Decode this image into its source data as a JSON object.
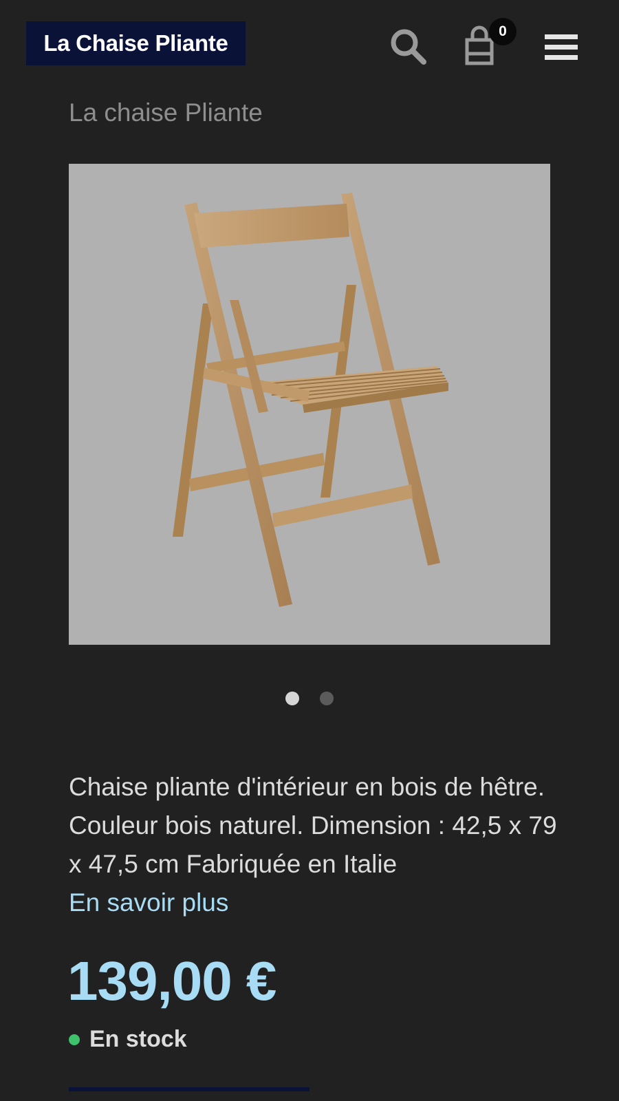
{
  "header": {
    "logo_text": "La Chaise Pliante",
    "cart_count": "0",
    "icons": {
      "search": "search-icon",
      "cart": "shopping-bag-icon",
      "menu": "hamburger-menu-icon"
    },
    "colors": {
      "logo_background": "#0b1238",
      "badge_background": "#0a0a0a"
    }
  },
  "product": {
    "heading": "La chaise Pliante",
    "image_alt": "folding-chair-image",
    "carousel": {
      "total_slides": 2,
      "active_slide": 1
    },
    "description": "Chaise pliante d'intérieur en bois de hêtre. Couleur bois naturel. Dimension : 42,5 x 79 x 47,5 cm Fabriquée en Italie",
    "learn_more_label": "En savoir plus",
    "price": "139,00 €",
    "stock_status": "En stock",
    "colors": {
      "accent": "#a8dcf4",
      "stock_indicator": "#3fc26c",
      "page_background": "#212121"
    }
  }
}
